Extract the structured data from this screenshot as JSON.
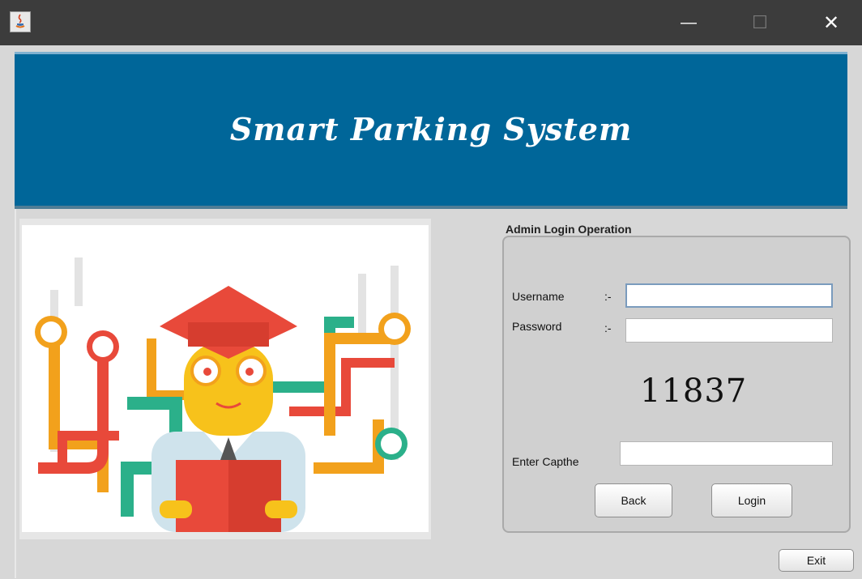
{
  "window": {
    "title": "",
    "controls": {
      "minimize_glyph": "—",
      "maximize_glyph": "☐",
      "close_glyph": "✕"
    },
    "icon": "java-icon"
  },
  "banner": {
    "title": "Smart Parking System",
    "background": "#006699"
  },
  "illustration": {
    "name": "graduate-reading-book-illustration"
  },
  "login_panel": {
    "title": "Admin Login Operation",
    "username_label": "Username",
    "username_sep": ":-",
    "username_value": "",
    "password_label": "Password",
    "password_sep": ":-",
    "password_value": "",
    "captcha_code": "11837",
    "captcha_label": "Enter Capthe",
    "captcha_value": "",
    "back_label": "Back",
    "login_label": "Login"
  },
  "exit_label": "Exit"
}
